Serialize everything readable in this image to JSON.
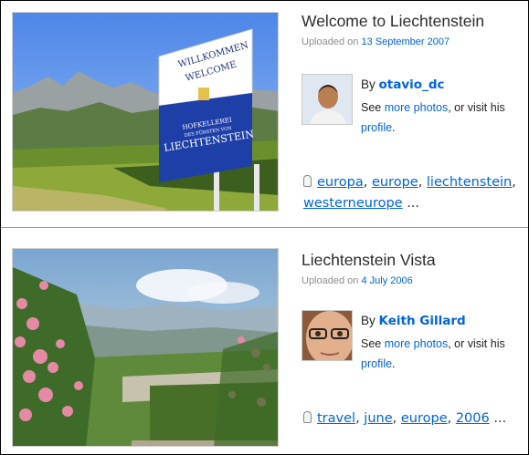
{
  "photos": [
    {
      "title": "Welcome to Liechtenstein",
      "uploaded_prefix": "Uploaded on",
      "uploaded_date": "13 September 2007",
      "by_prefix": "By",
      "username": "otavio_dc",
      "see_prefix": "See",
      "more_photos": "more photos",
      "visit_text": ", or visit his",
      "profile": "profile",
      "period": ".",
      "tags": [
        "europa",
        "europe",
        "liechtenstein",
        "westerneurope"
      ],
      "ellipsis": "...",
      "sign_text": [
        "WILLKOMMEN",
        "WELCOME",
        "HOFKELLEREI",
        "DES FÜRSTEN VON",
        "LIECHTENSTEIN"
      ]
    },
    {
      "title": "Liechtenstein Vista",
      "uploaded_prefix": "Uploaded on",
      "uploaded_date": "4 July 2006",
      "by_prefix": "By",
      "username": "Keith Gillard",
      "see_prefix": "See",
      "more_photos": "more photos",
      "visit_text": ", or visit his",
      "profile": "profile",
      "period": ".",
      "tags": [
        "travel",
        "june",
        "europe",
        "2006"
      ],
      "ellipsis": "..."
    }
  ],
  "colors": {
    "link": "#0063dc",
    "meta": "#8c8c8c",
    "title": "#2b2b2b"
  },
  "icons": {
    "tag": "tag-icon"
  }
}
